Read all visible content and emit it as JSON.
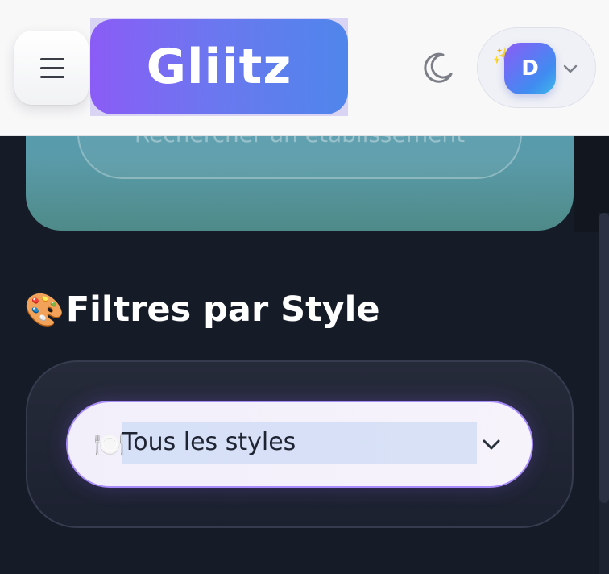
{
  "header": {
    "logo_text": "Gliitz",
    "profile": {
      "avatar_initial": "D",
      "sparkle_icon": "✨"
    }
  },
  "hero": {
    "search_placeholder": "Rechercher un établissement"
  },
  "filters": {
    "section_emoji": "🎨",
    "section_title": "Filtres par Style",
    "style_select": {
      "icon": "🍽️",
      "selected_value": "Tous les styles"
    }
  },
  "colors": {
    "background": "#161b28",
    "header_bg": "#f8f8f9",
    "logo_gradient_start": "#8b5cf6",
    "logo_gradient_end": "#4f86ec",
    "select_border": "#a78bfa",
    "hero_teal": "#5a9ba9"
  },
  "icons": [
    "menu-icon",
    "moon-icon",
    "sparkle-icon",
    "chevron-down-icon",
    "palette-icon",
    "plate-cutlery-icon"
  ]
}
